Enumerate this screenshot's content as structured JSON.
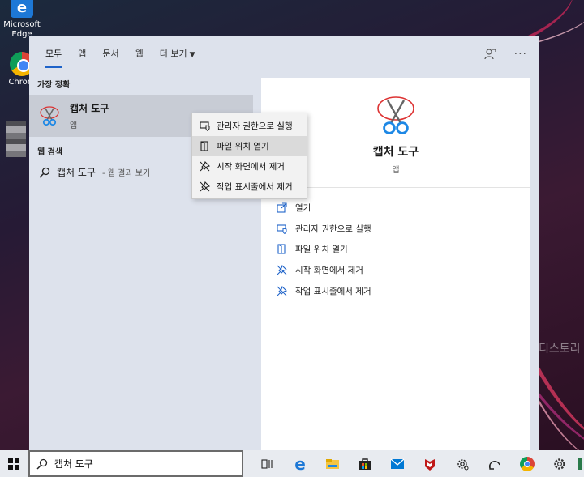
{
  "desktop": {
    "icons": [
      {
        "label_line1": "Microsoft",
        "label_line2": "Edge"
      },
      {
        "label_line1": "Chrom",
        "label_line2": ""
      }
    ],
    "watermark": "티스토리"
  },
  "tabs": [
    {
      "label": "모두",
      "active": true
    },
    {
      "label": "앱",
      "active": false
    },
    {
      "label": "문서",
      "active": false
    },
    {
      "label": "웹",
      "active": false
    },
    {
      "label": "더 보기",
      "active": false
    }
  ],
  "best_match": {
    "section": "가장 정확",
    "title": "캡처 도구",
    "subtitle": "앱"
  },
  "web_search": {
    "section": "웹 검색",
    "query": "캡처 도구",
    "suffix": "- 웹 결과 보기"
  },
  "detail": {
    "title": "캡처 도구",
    "subtitle": "앱",
    "actions": [
      {
        "label": "열기",
        "icon": "open-icon"
      },
      {
        "label": "관리자 권한으로 실행",
        "icon": "admin-shield-icon"
      },
      {
        "label": "파일 위치 열기",
        "icon": "folder-location-icon"
      },
      {
        "label": "시작 화면에서 제거",
        "icon": "unpin-icon"
      },
      {
        "label": "작업 표시줄에서 제거",
        "icon": "unpin-icon"
      }
    ]
  },
  "context_menu": {
    "items": [
      {
        "label": "관리자 권한으로 실행",
        "icon": "admin-shield-icon",
        "highlighted": false
      },
      {
        "label": "파일 위치 열기",
        "icon": "folder-location-icon",
        "highlighted": true
      },
      {
        "label": "시작 화면에서 제거",
        "icon": "unpin-icon",
        "highlighted": false
      },
      {
        "label": "작업 표시줄에서 제거",
        "icon": "unpin-icon",
        "highlighted": false
      }
    ]
  },
  "taskbar": {
    "search_value": "캡처 도구",
    "apps": [
      "task-view-icon",
      "edge-icon",
      "file-explorer-icon",
      "store-icon",
      "mail-icon",
      "mcafee-icon",
      "settings-gear-icon",
      "feedback-icon",
      "chrome-icon",
      "settings-icon"
    ]
  }
}
